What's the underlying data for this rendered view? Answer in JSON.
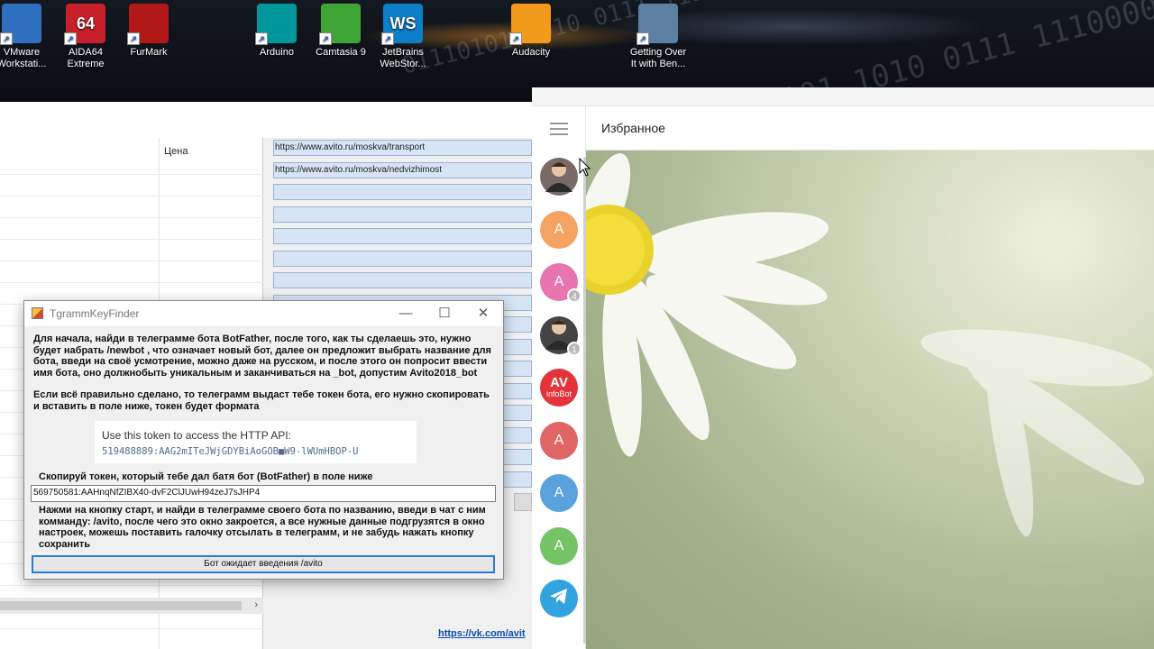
{
  "desktop": {
    "binary_text": "01110101 1010 0111 11100000",
    "icons": [
      {
        "label": "VMware Workstati...",
        "icon": "vmware-icon",
        "color": "#2f6fbf"
      },
      {
        "label": "AIDA64 Extreme",
        "icon": "aida64-icon",
        "color": "#c8202a",
        "glyph": "64"
      },
      {
        "label": "FurMark",
        "icon": "furmark-icon",
        "color": "#b31818"
      },
      {
        "label": "Arduino",
        "icon": "arduino-icon",
        "color": "#00979c"
      },
      {
        "label": "Camtasia 9",
        "icon": "camtasia-icon",
        "color": "#3fa535"
      },
      {
        "label": "JetBrains WebStor...",
        "icon": "webstorm-icon",
        "color": "#0d7ec8",
        "glyph": "WS"
      },
      {
        "label": "Audacity",
        "icon": "audacity-icon",
        "color": "#f29a1b"
      },
      {
        "label": "Getting Over It with Ben...",
        "icon": "getting-over-it-icon",
        "color": "#5d7fa1"
      }
    ]
  },
  "bgapp": {
    "price_header": "Цена",
    "urls": [
      "https://www.avito.ru/moskva/transport",
      "https://www.avito.ru/moskva/nedvizhimost",
      "",
      "",
      "",
      "",
      "",
      "",
      "",
      "",
      "",
      "",
      "",
      "",
      "",
      ""
    ],
    "vk_link": "https://vk.com/avit"
  },
  "dialog": {
    "title": "TgrammKeyFinder",
    "intro": "Для начала, найди в телеграмме бота BotFather, после того, как ты сделаешь это, нужно будет набрать /newbot , что означает новый бот, далее он предложит выбрать название для бота, введи на своё усмотрение, можно даже на русском, и после этого он попросит ввести имя бота, оно должнобыть уникальным и заканчиваться на _bot, допустим Avito2018_bot",
    "intro2": "Если всё правильно сделано, то телеграмм выдаст тебе токен бота, его нужно скопировать и вставить в поле ниже, токен будет формата",
    "token_title": "Use this token to access the HTTP API:",
    "token_example": "519488889:AAG2mITeJWjGDYBiAoGOB■W9-lWUmHBOP-U",
    "copy_label": "Скопируй токен, который тебе дал батя бот (BotFather) в поле ниже",
    "token_value": "569750581:AAHnqNfZIBX40-dvF2ClJUwH94zeJ7sJHP4",
    "instructions": "Нажми на кнопку старт, и найди в телеграмме своего бота по названию, введи в чат с ним комманду:    /avito, после чего это окно закроется, а все нужные данные подгрузятся в окно настроек, можешь поставить галочку отсылать в телеграмм, и не забудь нажать кнопку сохранить",
    "button": "Бот ожидает введения /avito",
    "controls": {
      "minimize": "—",
      "maximize": "☐",
      "close": "✕"
    }
  },
  "telegram": {
    "chat_title": "Избранное",
    "chats": [
      {
        "type": "photo",
        "icon": "user-photo-avatar",
        "color": "#7a6a66"
      },
      {
        "letter": "A",
        "color": "#f4a362"
      },
      {
        "letter": "A",
        "color": "#e875b0",
        "badge": "4"
      },
      {
        "type": "photo",
        "icon": "man-photo-avatar",
        "color": "#444",
        "badge": "1"
      },
      {
        "letter": "AV",
        "sub": "infoBot",
        "color": "#e5333b"
      },
      {
        "letter": "A",
        "color": "#e06565"
      },
      {
        "letter": "A",
        "color": "#5aa2de"
      },
      {
        "letter": "A",
        "color": "#74c365"
      },
      {
        "type": "telegram",
        "icon": "telegram-icon",
        "color": "#32a3df"
      }
    ]
  }
}
